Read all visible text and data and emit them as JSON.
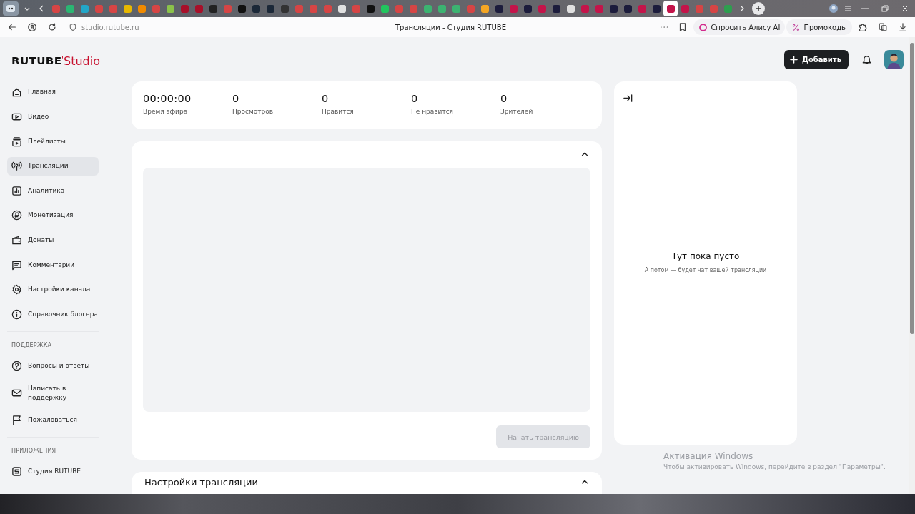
{
  "browser": {
    "tabs": [
      {
        "color": "#d64545",
        "selected": false
      },
      {
        "color": "#2bb673",
        "selected": false
      },
      {
        "color": "#22a6c8",
        "selected": false
      },
      {
        "color": "#d64545",
        "selected": false
      },
      {
        "color": "#d64545",
        "selected": false
      },
      {
        "color": "#e8b800",
        "selected": false
      },
      {
        "color": "#f08a00",
        "selected": false
      },
      {
        "color": "#d64545",
        "selected": false
      },
      {
        "color": "#8bc34a",
        "selected": false
      },
      {
        "color": "#a8102a",
        "selected": false
      },
      {
        "color": "#a8102a",
        "selected": false
      },
      {
        "color": "#222222",
        "selected": false
      },
      {
        "color": "#d64545",
        "selected": false
      },
      {
        "color": "#111111",
        "selected": false
      },
      {
        "color": "#1b2838",
        "selected": false
      },
      {
        "color": "#1b2838",
        "selected": false
      },
      {
        "color": "#333333",
        "selected": false
      },
      {
        "color": "#d64545",
        "selected": false
      },
      {
        "color": "#d64545",
        "selected": false
      },
      {
        "color": "#d64545",
        "selected": false
      },
      {
        "color": "#e0e0e0",
        "selected": false
      },
      {
        "color": "#d64545",
        "selected": false
      },
      {
        "color": "#111111",
        "selected": false
      },
      {
        "color": "#22c55e",
        "selected": false
      },
      {
        "color": "#d64545",
        "selected": false
      },
      {
        "color": "#d64545",
        "selected": false
      },
      {
        "color": "#3cb371",
        "selected": false
      },
      {
        "color": "#3cb371",
        "selected": false
      },
      {
        "color": "#3cb371",
        "selected": false
      },
      {
        "color": "#d64545",
        "selected": false
      },
      {
        "color": "#f5a623",
        "selected": false
      },
      {
        "color": "#1c1c3c",
        "selected": false
      },
      {
        "color": "#c4144a",
        "selected": false
      },
      {
        "color": "#1c1c3c",
        "selected": false
      },
      {
        "color": "#c4144a",
        "selected": false
      },
      {
        "color": "#1c1c3c",
        "selected": false
      },
      {
        "color": "#e0e0e0",
        "selected": false
      },
      {
        "color": "#c4144a",
        "selected": false
      },
      {
        "color": "#c4144a",
        "selected": false
      },
      {
        "color": "#1c1c3c",
        "selected": false
      },
      {
        "color": "#1c1c3c",
        "selected": false
      },
      {
        "color": "#c4144a",
        "selected": false
      },
      {
        "color": "#1c1c3c",
        "selected": false
      },
      {
        "color": "#c4144a",
        "selected": true
      },
      {
        "color": "#c4144a",
        "selected": false
      },
      {
        "color": "#d64545",
        "selected": false
      },
      {
        "color": "#d64545",
        "selected": false
      },
      {
        "color": "#2e9e4f",
        "selected": false
      }
    ],
    "address": "studio.rutube.ru",
    "page_title": "Трансляции - Студия RUTUBE",
    "ask_button": "Спросить Алису AI",
    "promo_button": "Промокоды"
  },
  "logo": {
    "brand": "RUTUBE",
    "product": "Studio"
  },
  "sidebar": {
    "sections": [
      {
        "items": [
          {
            "label": "Главная",
            "kind": "home",
            "selected": false
          },
          {
            "label": "Видео",
            "kind": "video",
            "selected": false
          },
          {
            "label": "Плейлисты",
            "kind": "playlist",
            "selected": false
          },
          {
            "label": "Трансляции",
            "kind": "broadcast",
            "selected": true
          },
          {
            "label": "Аналитика",
            "kind": "analytics",
            "selected": false
          },
          {
            "label": "Монетизация",
            "kind": "ruble",
            "selected": false
          },
          {
            "label": "Донаты",
            "kind": "wallet",
            "selected": false
          },
          {
            "label": "Комментарии",
            "kind": "comment",
            "selected": false
          },
          {
            "label": "Настройки канала",
            "kind": "gear",
            "selected": false
          },
          {
            "label": "Справочник блогера",
            "kind": "info",
            "selected": false
          }
        ]
      },
      {
        "heading": "ПОДДЕРЖКА",
        "items": [
          {
            "label": "Вопросы и ответы",
            "kind": "question",
            "selected": false
          },
          {
            "label": "Написать в поддержку",
            "kind": "mail",
            "selected": false
          },
          {
            "label": "Пожаловаться",
            "kind": "flag",
            "selected": false
          }
        ]
      },
      {
        "heading": "ПРИЛОЖЕНИЯ",
        "items": [
          {
            "label": "Студия RUTUBE",
            "kind": "studio",
            "selected": false
          }
        ]
      }
    ]
  },
  "header": {
    "add_button": "Добавить"
  },
  "stats": [
    {
      "value": "00:00:00",
      "label": "Время эфира"
    },
    {
      "value": "0",
      "label": "Просмотров"
    },
    {
      "value": "0",
      "label": "Нравится"
    },
    {
      "value": "0",
      "label": "Не нравится"
    },
    {
      "value": "0",
      "label": "Зрителей"
    }
  ],
  "player": {
    "expanded": true,
    "start_button": {
      "label": "Начать трансляцию",
      "disabled": true
    }
  },
  "settings": {
    "title": "Настройки трансляции",
    "expanded": true
  },
  "chat": {
    "title": "Тут пока пусто",
    "subtitle": "А потом — будет чат вашей трансляции"
  },
  "windows_notice": {
    "title": "Активация Windows",
    "text": "Чтобы активировать Windows, перейдите в раздел \"Параметры\"."
  }
}
